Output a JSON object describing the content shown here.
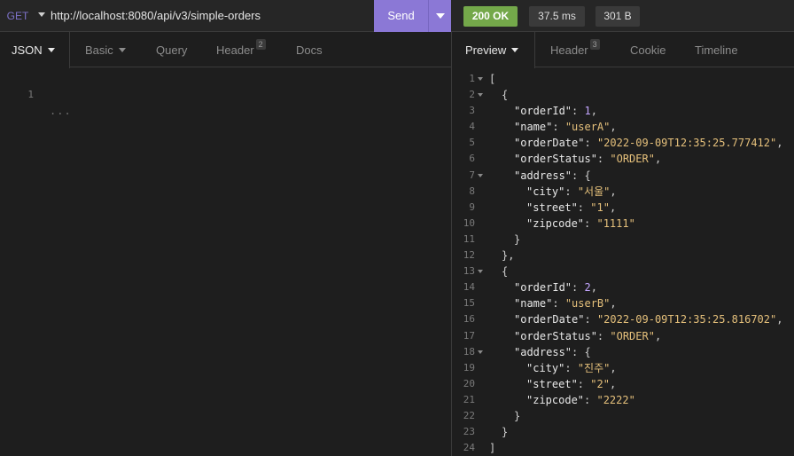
{
  "request": {
    "method": "GET",
    "url": "http://localhost:8080/api/v3/simple-orders",
    "send_label": "Send",
    "tabs": [
      {
        "label": "JSON",
        "active": true
      },
      {
        "label": "Basic"
      },
      {
        "label": "Query"
      },
      {
        "label": "Header",
        "count": "2"
      },
      {
        "label": "Docs"
      }
    ],
    "editor": {
      "line": "1",
      "placeholder": "..."
    }
  },
  "response": {
    "status": "200 OK",
    "time": "37.5 ms",
    "size": "301 B",
    "tabs": [
      {
        "label": "Preview",
        "active": true
      },
      {
        "label": "Header",
        "count": "3"
      },
      {
        "label": "Cookie"
      },
      {
        "label": "Timeline"
      }
    ],
    "body_lines": [
      {
        "n": "1",
        "fold": true,
        "indent": 0,
        "tokens": [
          [
            "p",
            "["
          ]
        ]
      },
      {
        "n": "2",
        "fold": true,
        "indent": 1,
        "tokens": [
          [
            "p",
            "{"
          ]
        ]
      },
      {
        "n": "3",
        "indent": 2,
        "tokens": [
          [
            "k",
            "\"orderId\""
          ],
          [
            "p",
            ": "
          ],
          [
            "n",
            "1"
          ],
          [
            "p",
            ","
          ]
        ]
      },
      {
        "n": "4",
        "indent": 2,
        "tokens": [
          [
            "k",
            "\"name\""
          ],
          [
            "p",
            ": "
          ],
          [
            "s",
            "\"userA\""
          ],
          [
            "p",
            ","
          ]
        ]
      },
      {
        "n": "5",
        "indent": 2,
        "tokens": [
          [
            "k",
            "\"orderDate\""
          ],
          [
            "p",
            ": "
          ],
          [
            "s",
            "\"2022-09-09T12:35:25.777412\""
          ],
          [
            "p",
            ","
          ]
        ]
      },
      {
        "n": "6",
        "indent": 2,
        "tokens": [
          [
            "k",
            "\"orderStatus\""
          ],
          [
            "p",
            ": "
          ],
          [
            "s",
            "\"ORDER\""
          ],
          [
            "p",
            ","
          ]
        ]
      },
      {
        "n": "7",
        "fold": true,
        "indent": 2,
        "tokens": [
          [
            "k",
            "\"address\""
          ],
          [
            "p",
            ": {"
          ]
        ]
      },
      {
        "n": "8",
        "indent": 3,
        "tokens": [
          [
            "k",
            "\"city\""
          ],
          [
            "p",
            ": "
          ],
          [
            "s",
            "\"서울\""
          ],
          [
            "p",
            ","
          ]
        ]
      },
      {
        "n": "9",
        "indent": 3,
        "tokens": [
          [
            "k",
            "\"street\""
          ],
          [
            "p",
            ": "
          ],
          [
            "s",
            "\"1\""
          ],
          [
            "p",
            ","
          ]
        ]
      },
      {
        "n": "10",
        "indent": 3,
        "tokens": [
          [
            "k",
            "\"zipcode\""
          ],
          [
            "p",
            ": "
          ],
          [
            "s",
            "\"1111\""
          ]
        ]
      },
      {
        "n": "11",
        "indent": 2,
        "tokens": [
          [
            "p",
            "}"
          ]
        ]
      },
      {
        "n": "12",
        "indent": 1,
        "tokens": [
          [
            "p",
            "},"
          ]
        ]
      },
      {
        "n": "13",
        "fold": true,
        "indent": 1,
        "tokens": [
          [
            "p",
            "{"
          ]
        ]
      },
      {
        "n": "14",
        "indent": 2,
        "tokens": [
          [
            "k",
            "\"orderId\""
          ],
          [
            "p",
            ": "
          ],
          [
            "n",
            "2"
          ],
          [
            "p",
            ","
          ]
        ]
      },
      {
        "n": "15",
        "indent": 2,
        "tokens": [
          [
            "k",
            "\"name\""
          ],
          [
            "p",
            ": "
          ],
          [
            "s",
            "\"userB\""
          ],
          [
            "p",
            ","
          ]
        ]
      },
      {
        "n": "16",
        "indent": 2,
        "tokens": [
          [
            "k",
            "\"orderDate\""
          ],
          [
            "p",
            ": "
          ],
          [
            "s",
            "\"2022-09-09T12:35:25.816702\""
          ],
          [
            "p",
            ","
          ]
        ]
      },
      {
        "n": "17",
        "indent": 2,
        "tokens": [
          [
            "k",
            "\"orderStatus\""
          ],
          [
            "p",
            ": "
          ],
          [
            "s",
            "\"ORDER\""
          ],
          [
            "p",
            ","
          ]
        ]
      },
      {
        "n": "18",
        "fold": true,
        "indent": 2,
        "tokens": [
          [
            "k",
            "\"address\""
          ],
          [
            "p",
            ": {"
          ]
        ]
      },
      {
        "n": "19",
        "indent": 3,
        "tokens": [
          [
            "k",
            "\"city\""
          ],
          [
            "p",
            ": "
          ],
          [
            "s",
            "\"진주\""
          ],
          [
            "p",
            ","
          ]
        ]
      },
      {
        "n": "20",
        "indent": 3,
        "tokens": [
          [
            "k",
            "\"street\""
          ],
          [
            "p",
            ": "
          ],
          [
            "s",
            "\"2\""
          ],
          [
            "p",
            ","
          ]
        ]
      },
      {
        "n": "21",
        "indent": 3,
        "tokens": [
          [
            "k",
            "\"zipcode\""
          ],
          [
            "p",
            ": "
          ],
          [
            "s",
            "\"2222\""
          ]
        ]
      },
      {
        "n": "22",
        "indent": 2,
        "tokens": [
          [
            "p",
            "}"
          ]
        ]
      },
      {
        "n": "23",
        "indent": 1,
        "tokens": [
          [
            "p",
            "}"
          ]
        ]
      },
      {
        "n": "24",
        "indent": 0,
        "tokens": [
          [
            "p",
            "]"
          ]
        ]
      }
    ]
  },
  "colors": {
    "accent": "#8b78d6",
    "method": "#7d72c9",
    "status_ok": "#74a84a",
    "string": "#e5c07b",
    "number": "#c3a6ff",
    "background": "#1e1e1e"
  },
  "icons": {
    "method_dropdown": "caret-down-icon",
    "send_dropdown": "caret-down-icon",
    "fold_marker": "fold-caret-icon"
  }
}
